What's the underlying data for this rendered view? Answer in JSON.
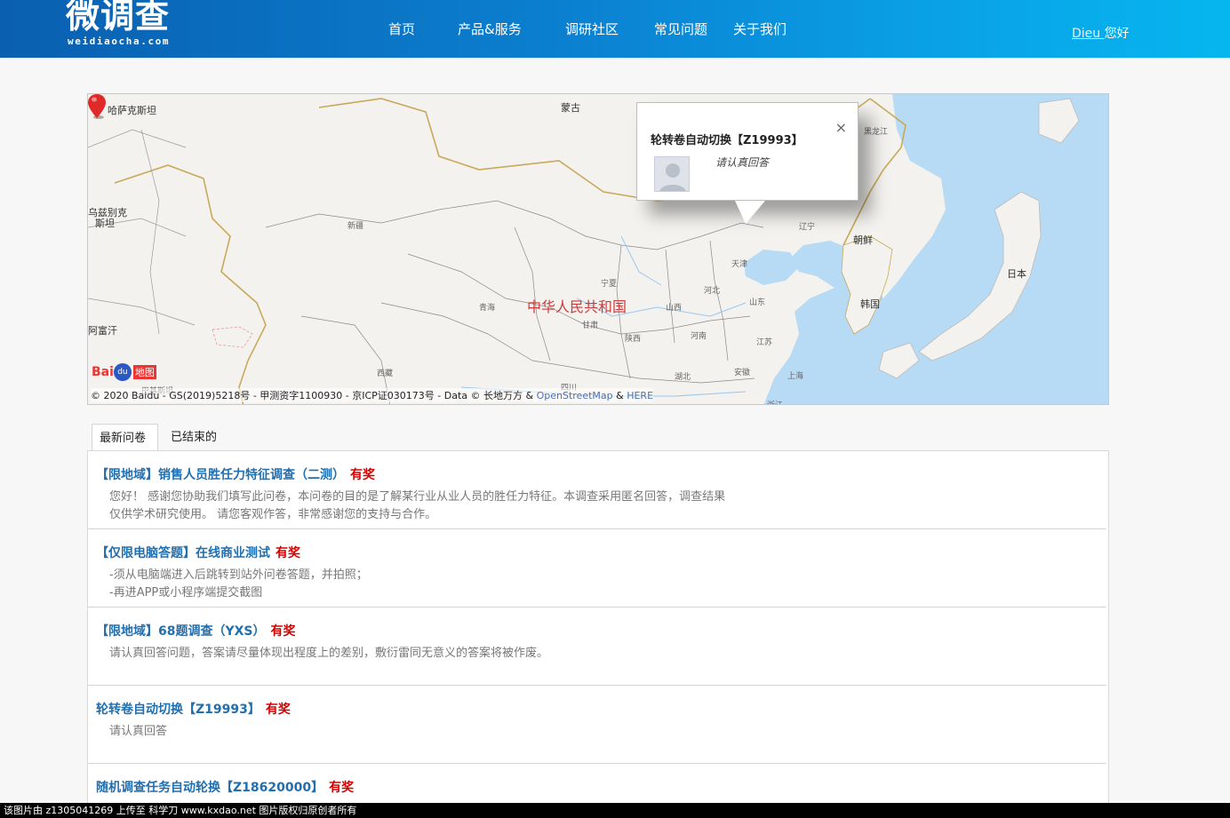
{
  "header": {
    "logo_main": "微调查",
    "logo_sub": "weidiaocha.com",
    "nav": [
      {
        "id": "home",
        "label": "首页"
      },
      {
        "id": "products",
        "label": "产品&服务"
      },
      {
        "id": "community",
        "label": "调研社区"
      },
      {
        "id": "faq",
        "label": "常见问题"
      },
      {
        "id": "about",
        "label": "关于我们"
      }
    ],
    "user_name": "Dieu ",
    "greeting": "您好"
  },
  "map": {
    "labels": {
      "kazakhstan": "哈萨克斯坦",
      "mongolia": "蒙古",
      "uzbekistan_1": "乌兹别克",
      "uzbekistan_2": "斯坦",
      "afghanistan": "阿富汗",
      "xinjiang": "新疆",
      "qinghai": "青海",
      "gansu": "甘肃",
      "ningxia": "宁夏",
      "shaanxi": "陕西",
      "shanxi": "山西",
      "hebei": "河北",
      "henan": "河南",
      "shandong": "山东",
      "jiangsu": "江苏",
      "anhui": "安徽",
      "hubei": "湖北",
      "sichuan": "四川",
      "tibet": "西藏",
      "zhejiang": "浙江",
      "shanghai": "上海",
      "tianjin": "天津",
      "liaoning": "辽宁",
      "heilongjiang": "黑龙江",
      "pakistan": "巴基斯坦",
      "china": "中华人民共和国",
      "north_korea": "朝鲜",
      "south_korea": "韩国",
      "japan": "日本"
    },
    "baidu_logo_text": "Bai",
    "baidu_logo_paw": "du",
    "baidu_logo_map": "地图",
    "copyright_prefix": "© 2020 Baidu - GS(2019)5218号 - 甲测资字1100930 - 京ICP证030173号 - Data © 长地万方 & ",
    "copyright_link1": "OpenStreetMap",
    "copyright_amp": " & ",
    "copyright_link2": "HERE",
    "popup": {
      "title": "轮转卷自动切换【Z19993】",
      "description": "请认真回答",
      "close": "×"
    },
    "colors": {
      "land": "#f3f2ef",
      "sea": "#b7daf5",
      "border": "#c8a95a",
      "marker": "#e02a2a"
    }
  },
  "tabs": [
    {
      "id": "latest",
      "label": "最新问卷",
      "active": true
    },
    {
      "id": "ended",
      "label": "已结束的",
      "active": false
    }
  ],
  "surveys": [
    {
      "title": "【限地域】销售人员胜任力特征调查（二测）",
      "prize": "有奖",
      "desc": [
        "　　　　　　　　　　　　　　　　　　　　　　　　　　　",
        "您好！ 感谢您协助我们填写此问卷，本问卷的目的是了解某行业从业人员的胜任力特征。本调查采用匿名回答，调查结果",
        "仅供学术研究使用。 请您客观作答，非常感谢您的支持与合作。"
      ]
    },
    {
      "title": "【仅限电脑答题】在线商业测试",
      "prize": "有奖",
      "desc": [
        "",
        "-须从电脑端进入后跳转到站外问卷答题，并拍照；",
        "-再进APP或小程序端提交截图"
      ]
    },
    {
      "title": "【限地域】68题调查（YXS）",
      "prize": "有奖",
      "desc": [
        "",
        "请认真回答问题，答案请尽量体现出程度上的差别，敷衍雷同无意义的答案将被作废。",
        ""
      ]
    },
    {
      "title": "轮转卷自动切换【Z19993】",
      "prize": "有奖",
      "desc": [
        "",
        "请认真回答",
        ""
      ]
    },
    {
      "title": "随机调查任务自动轮换【Z18620000】",
      "prize": "有奖",
      "desc": [
        "",
        "",
        ""
      ]
    }
  ],
  "watermark": "该图片由 z1305041269 上传至 科学刀 www.kxdao.net 图片版权归原创者所有"
}
